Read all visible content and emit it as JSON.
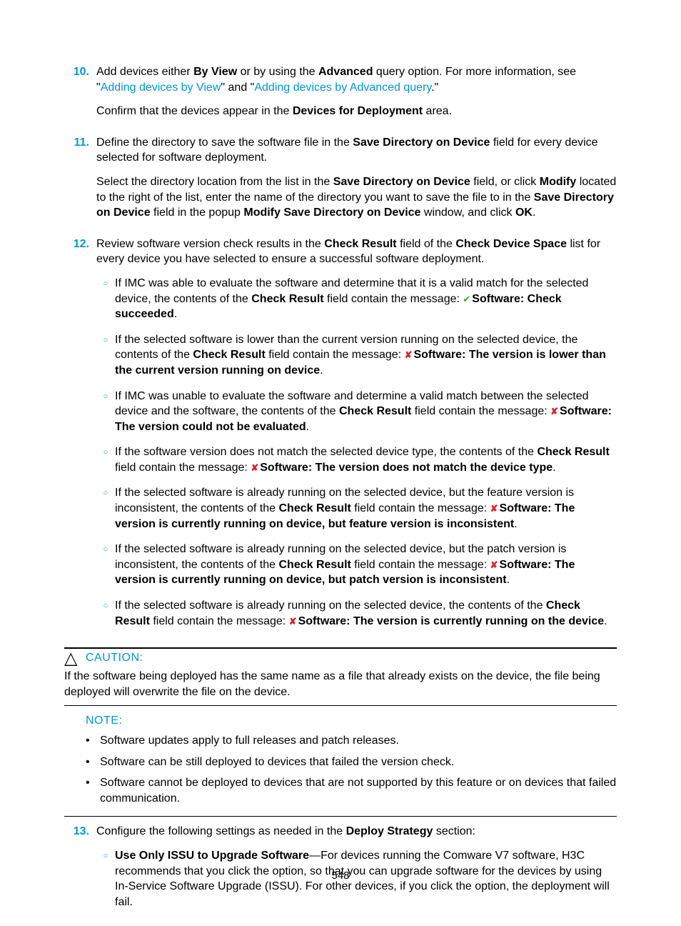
{
  "steps": {
    "s10": {
      "num": "10.",
      "p1_a": "Add devices either ",
      "p1_b": "By View",
      "p1_c": " or by using the ",
      "p1_d": "Advanced",
      "p1_e": " query option. For more information, see \"",
      "link1": "Adding devices by View",
      "p1_f": "\" and \"",
      "link2": "Adding devices by Advanced query",
      "p1_g": ".\"",
      "p2_a": "Confirm that the devices appear in the ",
      "p2_b": "Devices for Deployment",
      "p2_c": " area."
    },
    "s11": {
      "num": "11.",
      "p1_a": "Define the directory to save the software file in the ",
      "p1_b": "Save Directory on Device",
      "p1_c": " field for every device selected for software deployment.",
      "p2_a": "Select the directory location from the list in the ",
      "p2_b": "Save Directory on Device",
      "p2_c": " field, or click ",
      "p2_d": "Modify",
      "p2_e": " located to the right of the list, enter the name of the directory you want to save the file to in the ",
      "p2_f": "Save Directory on Device",
      "p2_g": " field in the popup ",
      "p2_h": "Modify Save Directory on Device",
      "p2_i": " window, and click ",
      "p2_j": "OK",
      "p2_k": "."
    },
    "s12": {
      "num": "12.",
      "p1_a": "Review software version check results in the ",
      "p1_b": "Check Result",
      "p1_c": " field of the ",
      "p1_d": "Check Device Space",
      "p1_e": " list for every device you have selected to ensure a successful software deployment.",
      "sub": [
        {
          "a": "If IMC was able to evaluate the software and determine that it is a valid match for the selected device, the contents of the ",
          "b": "Check Result",
          "c": " field contain the message: ",
          "mark": "check",
          "msg": "Software: Check succeeded",
          "post": "."
        },
        {
          "a": "If the selected software is lower than the current version running on the selected device, the contents of the ",
          "b": "Check Result",
          "c": " field contain the message: ",
          "mark": "cross",
          "msg": "Software: The version is lower than the current version running on device",
          "post": "."
        },
        {
          "a": "If IMC was unable to evaluate the software and determine a valid match between the selected device and the software, the contents of the ",
          "b": "Check Result",
          "c": " field contain the message: ",
          "mark": "cross",
          "msg": "Software: The version could not be evaluated",
          "post": "."
        },
        {
          "a": "If the software version does not match the selected device type, the contents of the ",
          "b": "Check Result",
          "c": " field contain the message: ",
          "mark": "cross",
          "msg": "Software: The version does not match the device type",
          "post": "."
        },
        {
          "a": "If the selected software is already running on the selected device, but the feature version is inconsistent, the contents of the ",
          "b": "Check Result",
          "c": " field contain the message: ",
          "mark": "cross",
          "msg": "Software: The version is currently running on device, but feature version is inconsistent",
          "post": "."
        },
        {
          "a": "If the selected software is already running on the selected device, but the patch version is inconsistent, the contents of the ",
          "b": "Check Result",
          "c": " field contain the message: ",
          "mark": "cross",
          "msg": "Software: The version is currently running on device, but patch version is inconsistent",
          "post": "."
        },
        {
          "a": "If the selected software is already running on the selected device, the contents of the ",
          "b": "Check Result",
          "c": " field contain the message: ",
          "mark": "cross",
          "msg": "Software: The version is currently running on the device",
          "post": "."
        }
      ]
    },
    "s13": {
      "num": "13.",
      "p1_a": "Configure the following settings as needed in the ",
      "p1_b": "Deploy Strategy",
      "p1_c": " section:",
      "sub": [
        {
          "b": "Use Only ISSU to Upgrade Software",
          "a": "—For devices running the Comware V7 software, H3C recommends that you click the option, so that you can upgrade software for the devices by using In-Service Software Upgrade (ISSU). For other devices, if you click the option, the deployment will fail."
        }
      ]
    }
  },
  "caution": {
    "label": "CAUTION:",
    "body": "If the software being deployed has the same name as a file that already exists on the device, the file being deployed will overwrite the file on the device."
  },
  "note": {
    "label": "NOTE:",
    "items": [
      "Software updates apply to full releases and patch releases.",
      "Software can be still deployed to devices that failed the version check.",
      "Software cannot be deployed to devices that are not supported by this feature or on devices that failed communication."
    ]
  },
  "page_num": "548"
}
